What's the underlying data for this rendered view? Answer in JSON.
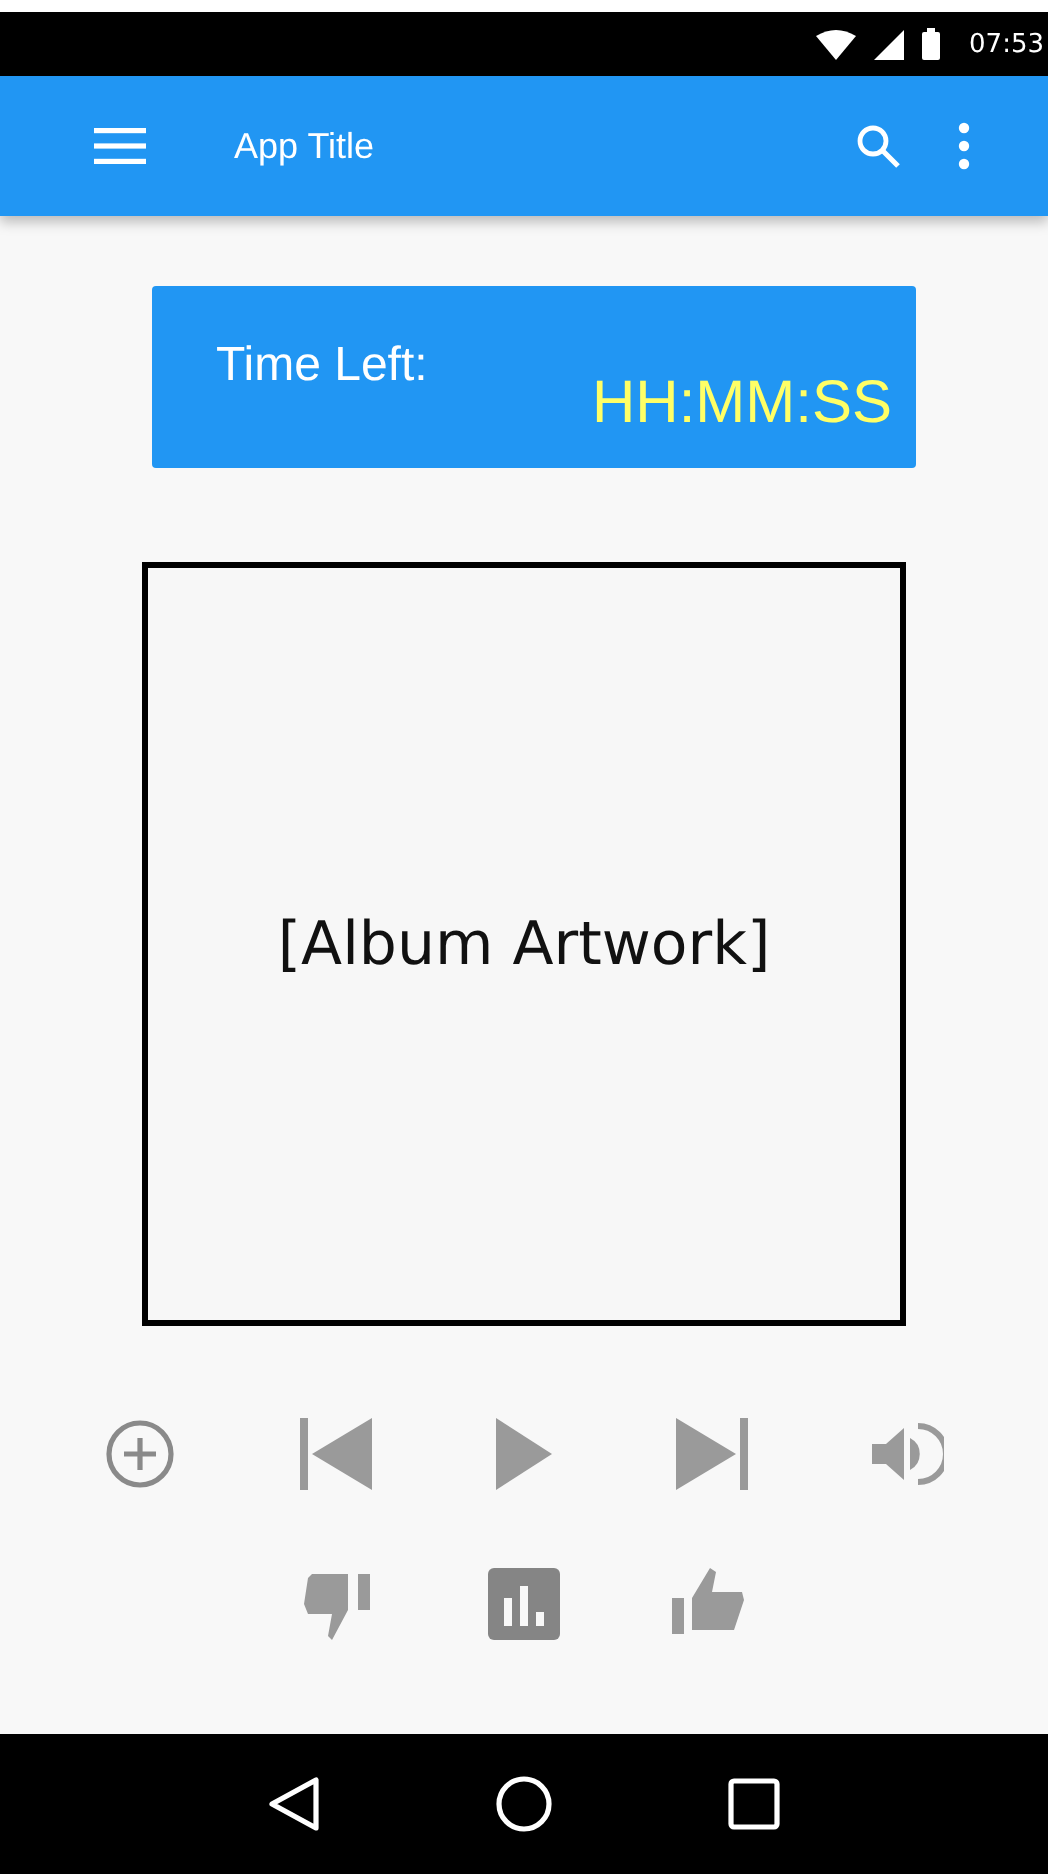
{
  "status_bar": {
    "time": "07:53"
  },
  "app_bar": {
    "title": "App Title"
  },
  "timer": {
    "label": "Time Left:",
    "value": "HH:MM:SS"
  },
  "artwork": {
    "placeholder": "[Album Artwork]"
  }
}
